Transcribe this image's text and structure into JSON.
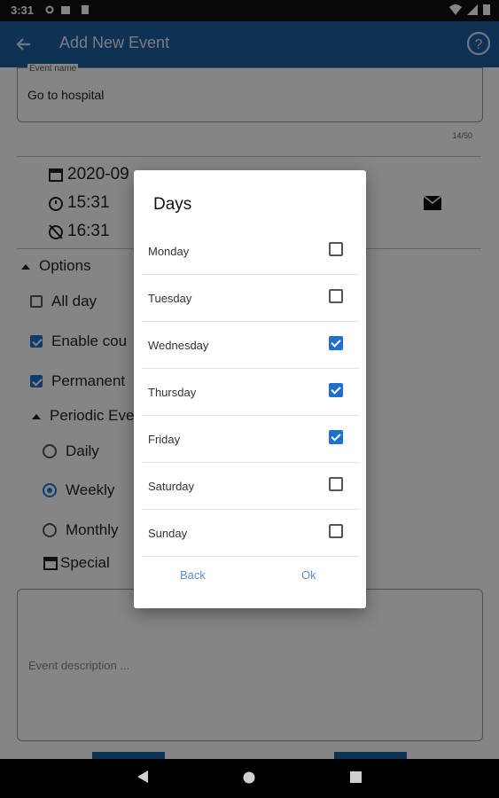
{
  "status_bar": {
    "time": "3:31"
  },
  "app_bar": {
    "title": "Add New Event"
  },
  "form": {
    "event_name_label": "Event name",
    "event_name_value": "Go to hospital",
    "char_counter": "14/50",
    "date": "2020-09",
    "start_time": "15:31",
    "end_time": "16:31",
    "options_label": "Options",
    "all_day_label": "All day",
    "enable_countdown_label": "Enable cou",
    "permanent_label": "Permanent",
    "periodic_label": "Periodic Eve",
    "daily_label": "Daily",
    "weekly_label": "Weekly",
    "monthly_label": "Monthly",
    "special_label": "Special",
    "description_placeholder": "Event description ..."
  },
  "dialog": {
    "title": "Days",
    "days": [
      {
        "label": "Monday",
        "checked": false
      },
      {
        "label": "Tuesday",
        "checked": false
      },
      {
        "label": "Wednesday",
        "checked": true
      },
      {
        "label": "Thursday",
        "checked": true
      },
      {
        "label": "Friday",
        "checked": true
      },
      {
        "label": "Saturday",
        "checked": false
      },
      {
        "label": "Sunday",
        "checked": false
      }
    ],
    "back_label": "Back",
    "ok_label": "Ok"
  },
  "colors": {
    "accent": "#1f5fa6",
    "checkbox": "#1f6fd0",
    "dialog_button": "#5a8fd8"
  }
}
